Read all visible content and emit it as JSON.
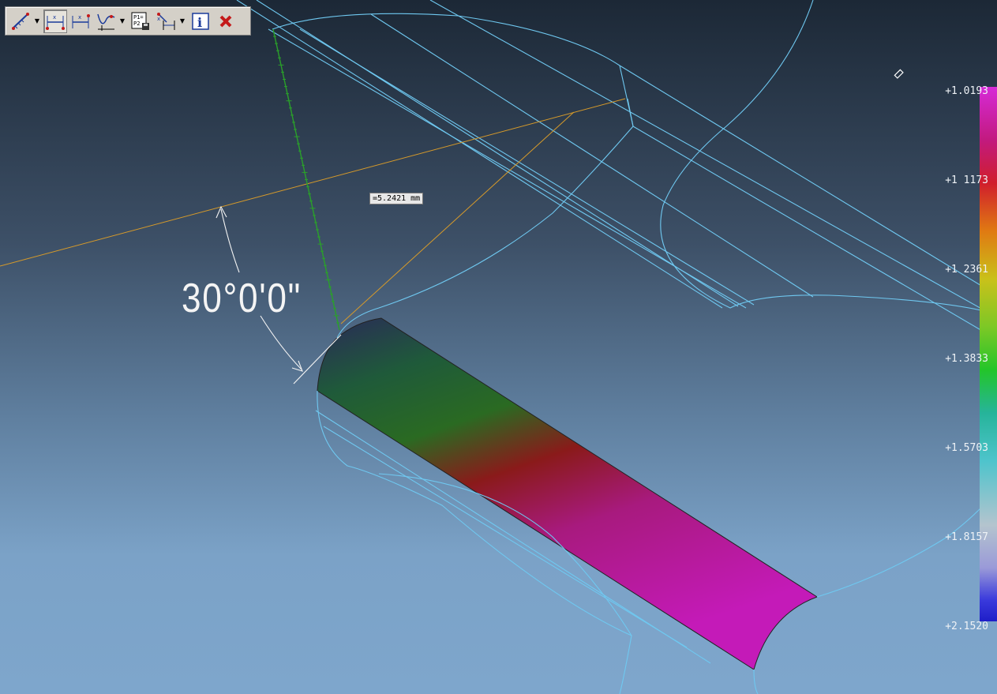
{
  "viewport": {
    "background": "gradient-dark-to-light-blue",
    "measure_label": "=5.2421 mm",
    "angle_label": "30°0'0\""
  },
  "toolbar": {
    "buttons": [
      {
        "name": "measure-distance",
        "icon": "ruler-icon",
        "has_dropdown": true
      },
      {
        "name": "horizontal-dimension",
        "icon": "horizontal-dimension-icon",
        "pressed": true
      },
      {
        "name": "horizontal-dimension-alt",
        "icon": "horizontal-dimension-alt-icon"
      },
      {
        "name": "curve-deviation",
        "icon": "curve-deviation-icon",
        "has_dropdown": true
      },
      {
        "name": "save-points",
        "icon": "save-points-icon",
        "text": "P1=P2"
      },
      {
        "name": "dimension-options",
        "icon": "dimension-options-icon",
        "has_dropdown": true
      },
      {
        "name": "info",
        "icon": "info-icon",
        "text": "i"
      },
      {
        "name": "close",
        "icon": "close-icon"
      }
    ]
  },
  "legend": {
    "values": [
      "+1.0193",
      "+1 1173",
      "+1 2361",
      "+1.3833",
      "+1.5703",
      "+1.8157",
      "+2.1520"
    ],
    "colors": [
      "#d62ad8",
      "#d01e2c",
      "#e07a12",
      "#23c52a",
      "#4ec4cc",
      "#b4c4ce",
      "#1e1ec8"
    ]
  },
  "colors": {
    "wireframe": "#6fc8f0",
    "dimension_line": "#d69a2a",
    "measure_ruler": "#2aa02a",
    "surface_top": "#2a2a55",
    "surface_bottom": "#c41ab8"
  }
}
